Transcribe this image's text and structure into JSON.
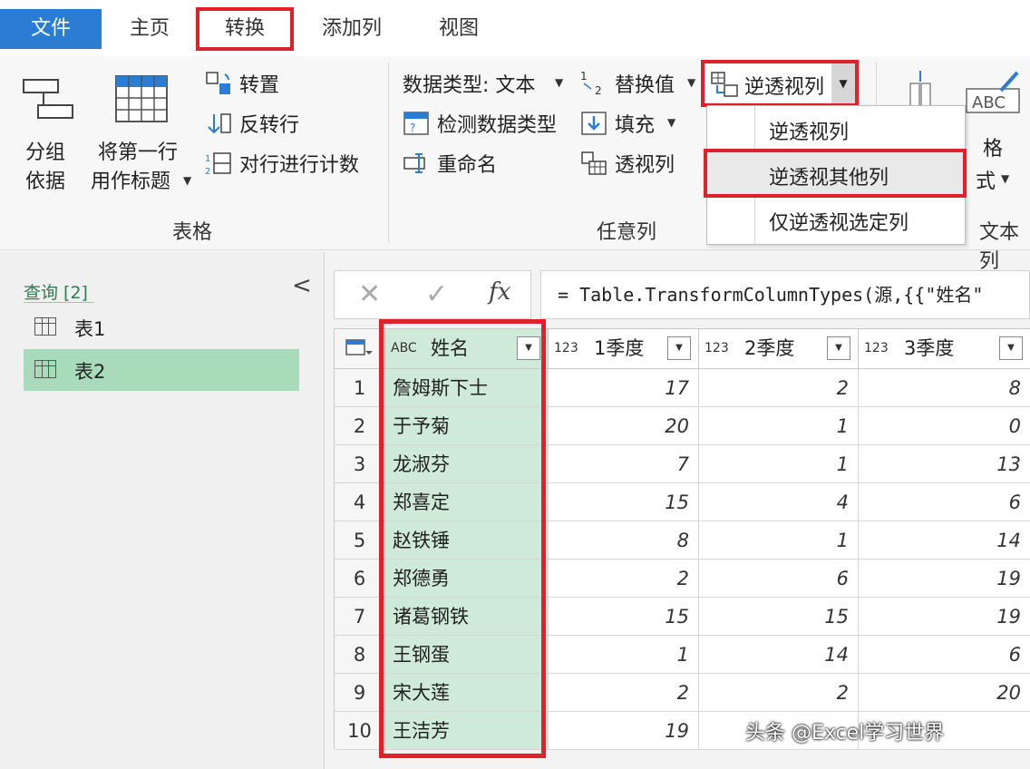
{
  "tabs": {
    "file": "文件",
    "home": "主页",
    "transform": "转换",
    "add_column": "添加列",
    "view": "视图"
  },
  "ribbon": {
    "table_group": {
      "group_by_line1": "分组",
      "group_by_line2": "依据",
      "first_row_line1": "将第一行",
      "first_row_line2": "用作标题",
      "transpose": "转置",
      "reverse_rows": "反转行",
      "count_rows": "对行进行计数",
      "label": "表格"
    },
    "any_column_group": {
      "data_type": "数据类型: 文本",
      "detect_type": "检测数据类型",
      "rename": "重命名",
      "replace_values": "替换值",
      "fill": "填充",
      "pivot": "透视列",
      "unpivot": "逆透视列",
      "label": "任意列"
    },
    "text_group": {
      "format_line1": "格",
      "format_line2": "式",
      "label": "文本列"
    }
  },
  "unpivot_menu": {
    "items": [
      "逆透视列",
      "逆透视其他列",
      "仅逆透视选定列"
    ],
    "highlighted_index": 1
  },
  "queries": {
    "header": "查询 [2]",
    "items": [
      {
        "label": "表1",
        "selected": false
      },
      {
        "label": "表2",
        "selected": true
      }
    ]
  },
  "formula_bar": {
    "cancel_symbol": "✕",
    "confirm_symbol": "✓",
    "fx_symbol": "fx",
    "formula": "= Table.TransformColumnTypes(源,{{\"姓名\""
  },
  "grid": {
    "columns": [
      {
        "type_icon": "ABC",
        "name": "姓名"
      },
      {
        "type_icon": "123",
        "name": "1季度"
      },
      {
        "type_icon": "123",
        "name": "2季度"
      },
      {
        "type_icon": "123",
        "name": "3季度"
      }
    ],
    "rows": [
      {
        "idx": "1",
        "name": "詹姆斯下士",
        "q1": "17",
        "q2": "2",
        "q3": "8"
      },
      {
        "idx": "2",
        "name": "于予菊",
        "q1": "20",
        "q2": "1",
        "q3": "0"
      },
      {
        "idx": "3",
        "name": "龙淑芬",
        "q1": "7",
        "q2": "1",
        "q3": "13"
      },
      {
        "idx": "4",
        "name": "郑喜定",
        "q1": "15",
        "q2": "4",
        "q3": "6"
      },
      {
        "idx": "5",
        "name": "赵铁锤",
        "q1": "8",
        "q2": "1",
        "q3": "14"
      },
      {
        "idx": "6",
        "name": "郑德勇",
        "q1": "2",
        "q2": "6",
        "q3": "19"
      },
      {
        "idx": "7",
        "name": "诸葛钢铁",
        "q1": "15",
        "q2": "15",
        "q3": "19"
      },
      {
        "idx": "8",
        "name": "王钢蛋",
        "q1": "1",
        "q2": "14",
        "q3": "6"
      },
      {
        "idx": "9",
        "name": "宋大莲",
        "q1": "2",
        "q2": "2",
        "q3": "20"
      },
      {
        "idx": "10",
        "name": "王洁芳",
        "q1": "19",
        "q2": "",
        "q3": ""
      }
    ]
  },
  "watermark": "头条 @Excel学习世界",
  "colors": {
    "accent_blue": "#2b7cd3",
    "highlight_red": "#e0202a",
    "selected_green": "#a7dbb9",
    "column_green": "#cfead8"
  }
}
